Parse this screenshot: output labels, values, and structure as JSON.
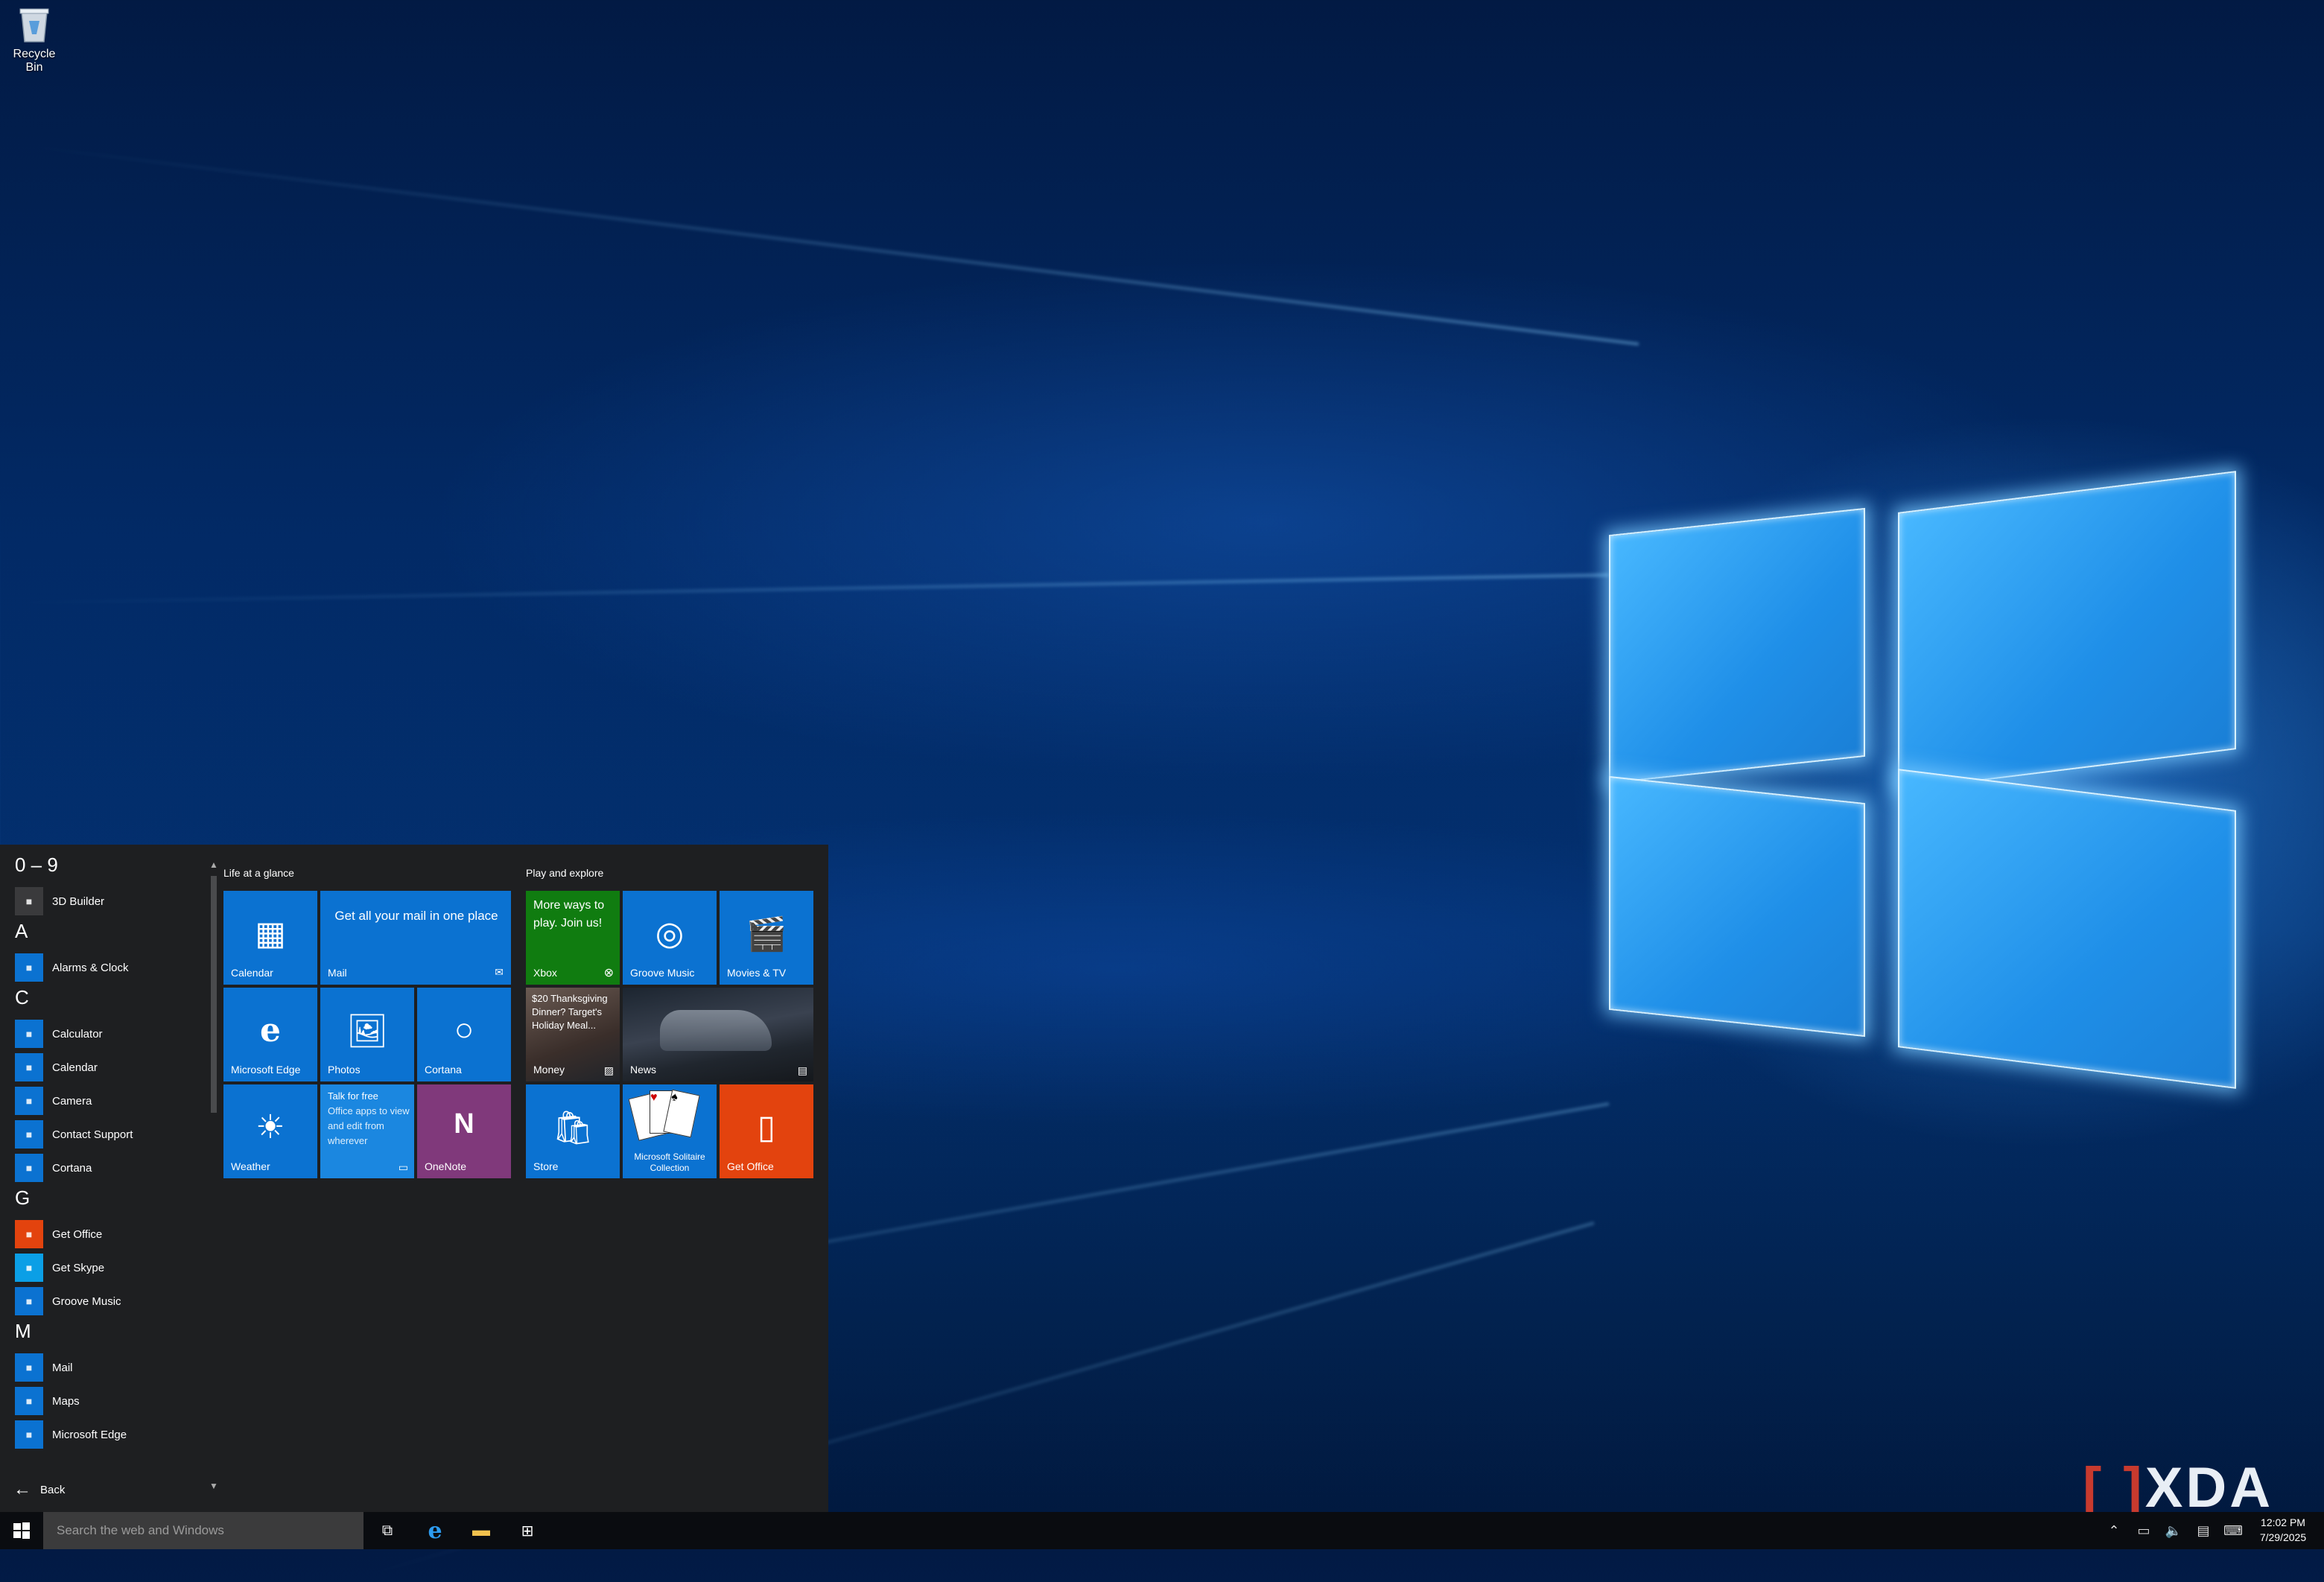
{
  "desktop": {
    "recycle_bin_label": "Recycle Bin",
    "watermark": "XDA"
  },
  "start_menu": {
    "app_list": [
      {
        "type": "header",
        "text": "0 – 9"
      },
      {
        "type": "app",
        "text": "3D Builder",
        "icon": "3d-builder-icon",
        "color": "#3a3a3c"
      },
      {
        "type": "header",
        "text": "A"
      },
      {
        "type": "app",
        "text": "Alarms & Clock",
        "icon": "alarm-clock-icon",
        "color": "#0b72d1"
      },
      {
        "type": "header",
        "text": "C"
      },
      {
        "type": "app",
        "text": "Calculator",
        "icon": "calculator-icon",
        "color": "#0b72d1"
      },
      {
        "type": "app",
        "text": "Calendar",
        "icon": "calendar-icon",
        "color": "#0b72d1"
      },
      {
        "type": "app",
        "text": "Camera",
        "icon": "camera-icon",
        "color": "#0b72d1"
      },
      {
        "type": "app",
        "text": "Contact Support",
        "icon": "contact-support-icon",
        "color": "#0b72d1"
      },
      {
        "type": "app",
        "text": "Cortana",
        "icon": "cortana-icon",
        "color": "#0b72d1"
      },
      {
        "type": "header",
        "text": "G"
      },
      {
        "type": "app",
        "text": "Get Office",
        "icon": "office-icon",
        "color": "#e3430e"
      },
      {
        "type": "app",
        "text": "Get Skype",
        "icon": "skype-icon",
        "color": "#0b9fe6"
      },
      {
        "type": "app",
        "text": "Groove Music",
        "icon": "groove-music-icon",
        "color": "#0b72d1"
      },
      {
        "type": "header",
        "text": "M"
      },
      {
        "type": "app",
        "text": "Mail",
        "icon": "mail-icon",
        "color": "#0b72d1"
      },
      {
        "type": "app",
        "text": "Maps",
        "icon": "maps-icon",
        "color": "#0b72d1"
      },
      {
        "type": "app",
        "text": "Microsoft Edge",
        "icon": "edge-icon",
        "color": "#0b72d1"
      }
    ],
    "back_label": "Back",
    "groups": {
      "life": "Life at a glance",
      "play": "Play and explore"
    },
    "tiles": {
      "calendar": "Calendar",
      "mail_body": "Get all your mail in one place",
      "mail": "Mail",
      "edge": "Microsoft Edge",
      "photos": "Photos",
      "cortana": "Cortana",
      "weather": "Weather",
      "office_promo_bold": "Talk for free",
      "office_promo_body": "Office apps to view and edit from wherever",
      "onenote": "OneNote",
      "xbox_body": "More ways to play. Join us!",
      "xbox": "Xbox",
      "groove": "Groove Music",
      "movies": "Movies & TV",
      "money_body": "$20 Thanksgiving Dinner? Target's Holiday Meal...",
      "money": "Money",
      "news": "News",
      "store": "Store",
      "solitaire": "Microsoft Solitaire Collection",
      "get_office": "Get Office"
    },
    "colors": {
      "tile_blue": "#0b72d1",
      "xbox_green": "#107c10",
      "onenote_purple": "#80397b",
      "office_orange": "#e3430e"
    }
  },
  "taskbar": {
    "search_placeholder": "Search the web and Windows",
    "time": "12:02 PM",
    "date": "7/29/2025"
  }
}
